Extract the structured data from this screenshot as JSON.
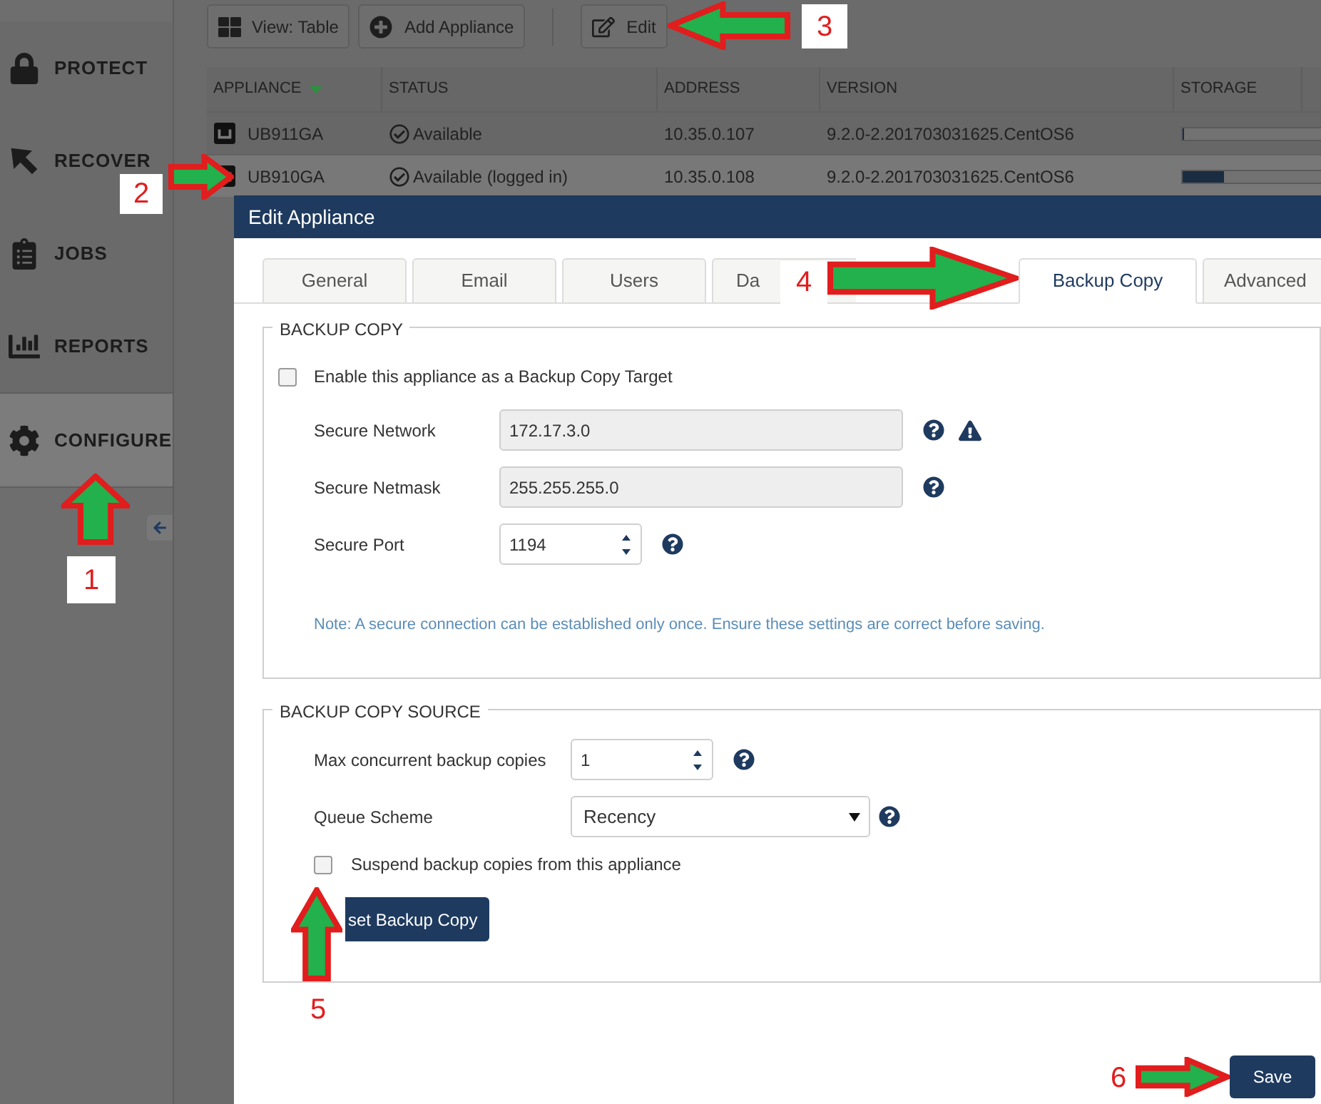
{
  "sidebar": {
    "items": [
      {
        "kind": "lock",
        "label": "PROTECT",
        "selected": false
      },
      {
        "kind": "recover",
        "label": "RECOVER",
        "selected": false
      },
      {
        "kind": "jobs",
        "label": "JOBS",
        "selected": false
      },
      {
        "kind": "reports",
        "label": "REPORTS",
        "selected": false
      },
      {
        "kind": "configure",
        "label": "CONFIGURE",
        "selected": true
      }
    ]
  },
  "toolbar": {
    "buttons": [
      {
        "kind": "view",
        "label": "View: Table"
      },
      {
        "kind": "add",
        "label": "Add Appliance"
      },
      {
        "kind": "edit",
        "label": "Edit"
      }
    ]
  },
  "table": {
    "columns": [
      {
        "label": "APPLIANCE",
        "sorted": true
      },
      {
        "label": "STATUS",
        "sorted": false
      },
      {
        "label": "ADDRESS",
        "sorted": false
      },
      {
        "label": "VERSION",
        "sorted": false
      },
      {
        "label": "STORAGE",
        "sorted": false
      }
    ],
    "rows": [
      {
        "appliance": "UB911GA",
        "status": "Available",
        "address": "10.35.0.107",
        "version": "9.2.0-2.201703031625.CentOS6",
        "storage": {
          "level": 0.01
        },
        "selected": false
      },
      {
        "appliance": "UB910GA",
        "status": "Available (logged in)",
        "address": "10.35.0.108",
        "version": "9.2.0-2.201703031625.CentOS6",
        "storage": {
          "level": 0.15
        },
        "selected": true
      }
    ]
  },
  "dialog": {
    "title": "Edit Appliance",
    "tabs": [
      {
        "label": "General",
        "selected": false
      },
      {
        "label": "Email",
        "selected": false
      },
      {
        "label": "Users",
        "selected": false
      },
      {
        "label": "Da",
        "selected": false
      },
      {
        "label": "Backup Copy",
        "selected": true
      },
      {
        "label": "Advanced",
        "selected": false
      }
    ],
    "backup_copy": {
      "title": "BACKUP COPY",
      "enable": {
        "label": "Enable this appliance as a Backup Copy Target",
        "checked": false
      },
      "fields": [
        {
          "kind": "text",
          "label": "Secure Network",
          "value": "172.17.3.0",
          "disabled": true,
          "help": true,
          "warning": true
        },
        {
          "kind": "text",
          "label": "Secure Netmask",
          "value": "255.255.255.0",
          "disabled": true,
          "help": true,
          "warning": false
        },
        {
          "kind": "spinner",
          "label": "Secure Port",
          "value": "1194",
          "disabled": false,
          "help": true,
          "warning": false
        }
      ],
      "note": "Note: A secure connection can be established only once. Ensure these settings are correct before saving."
    },
    "source": {
      "title": "BACKUP COPY SOURCE",
      "fields": [
        {
          "kind": "spinner",
          "label": "Max concurrent backup copies",
          "value": "1",
          "disabled": false,
          "help": true,
          "warning": false
        },
        {
          "kind": "select",
          "label": "Queue Scheme",
          "value": "Recency",
          "disabled": false,
          "help": true,
          "warning": false
        }
      ],
      "suspend": {
        "label": "Suspend backup copies from this appliance",
        "checked": false
      },
      "button": "set Backup Copy"
    },
    "save": "Save"
  },
  "annotations": [
    {
      "number": "1",
      "kind": "up"
    },
    {
      "number": "2",
      "kind": "right"
    },
    {
      "number": "3",
      "kind": "left"
    },
    {
      "number": "4",
      "kind": "right"
    },
    {
      "number": "5",
      "kind": "up"
    },
    {
      "number": "6",
      "kind": "right"
    }
  ]
}
